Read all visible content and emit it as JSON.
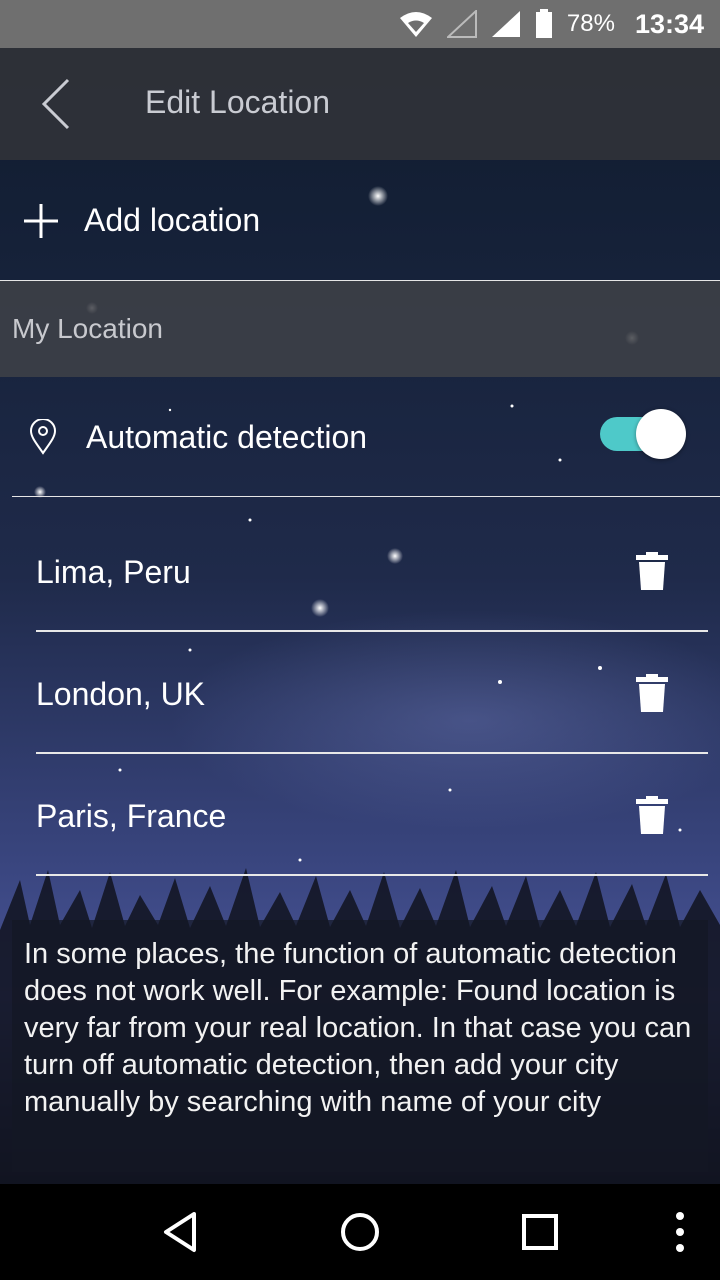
{
  "status": {
    "battery_pct": "78%",
    "time": "13:34"
  },
  "header": {
    "title": "Edit Location"
  },
  "add": {
    "label": "Add location"
  },
  "section": {
    "title": "My Location"
  },
  "auto": {
    "label": "Automatic detection",
    "enabled": true
  },
  "cities": [
    {
      "name": "Lima, Peru"
    },
    {
      "name": "London, UK"
    },
    {
      "name": "Paris, France"
    }
  ],
  "note": {
    "text": "In some places, the function of automatic detection does not work well. For example: Found location is very far from your real location. In that case you can turn off automatic detection, then add your city manually by searching with name of your city"
  },
  "colors": {
    "accent": "#4ec9c9",
    "statusbar": "#6f6f6f",
    "topbar": "#303238"
  }
}
